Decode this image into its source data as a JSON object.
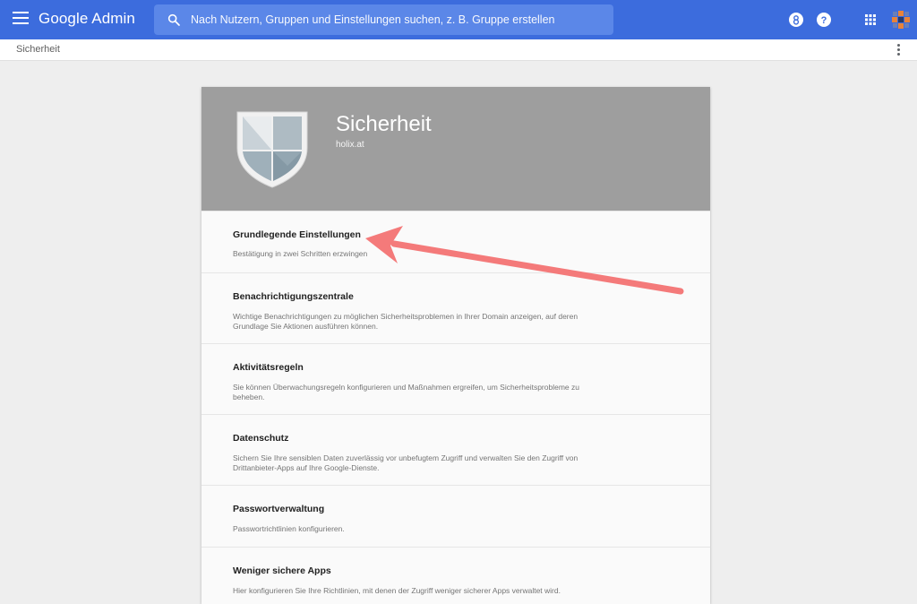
{
  "header": {
    "brand": "Google Admin",
    "search_placeholder": "Nach Nutzern, Gruppen und Einstellungen suchen, z. B. Gruppe erstellen",
    "icons": [
      "menu-icon",
      "search-icon",
      "support-icon",
      "help-icon",
      "apps-grid-icon",
      "account-avatar"
    ]
  },
  "breadcrumb": {
    "label": "Sicherheit"
  },
  "card": {
    "title": "Sicherheit",
    "subtitle": "holix.at",
    "sections": [
      {
        "title": "Grundlegende Einstellungen",
        "description": "Bestätigung in zwei Schritten erzwingen"
      },
      {
        "title": "Benachrichtigungszentrale",
        "description": "Wichtige Benachrichtigungen zu möglichen Sicherheitsproblemen in Ihrer Domain anzeigen, auf deren Grundlage Sie Aktionen ausführen können."
      },
      {
        "title": "Aktivitätsregeln",
        "description": "Sie können Überwachungsregeln konfigurieren und Maßnahmen ergreifen, um Sicherheitsprobleme zu beheben."
      },
      {
        "title": "Datenschutz",
        "description": "Sichern Sie Ihre sensiblen Daten zuverlässig vor unbefugtem Zugriff und verwalten Sie den Zugriff von Drittanbieter-Apps auf Ihre Google-Dienste."
      },
      {
        "title": "Passwortverwaltung",
        "description": "Passwortrichtlinien konfigurieren."
      },
      {
        "title": "Weniger sichere Apps",
        "description": "Hier konfigurieren Sie Ihre Richtlinien, mit denen der Zugriff weniger sicherer Apps verwaltet wird."
      }
    ]
  },
  "colors": {
    "topbar": "#3c6cdd",
    "header_bg": "#9e9e9e",
    "annotation_arrow": "#f47a7a"
  }
}
